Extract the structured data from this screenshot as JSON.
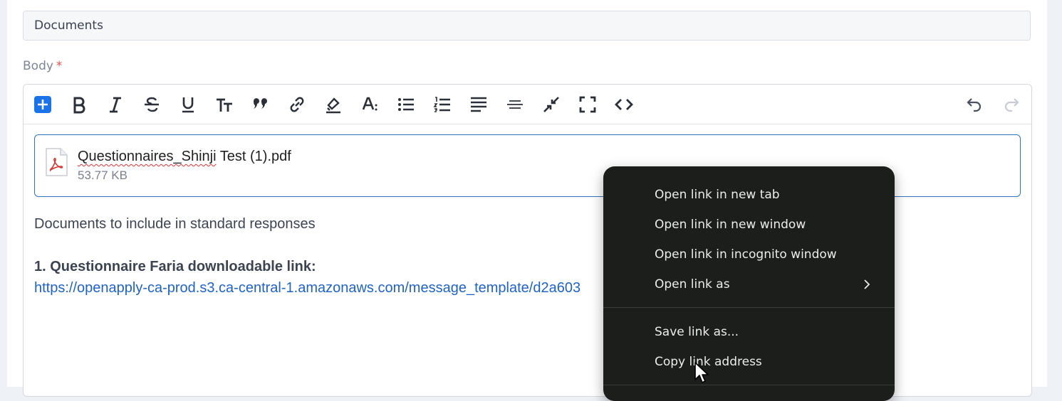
{
  "subject": {
    "value": "Documents"
  },
  "body_field": {
    "label": "Body",
    "required_marker": "*"
  },
  "toolbar": {
    "left_buttons": [
      "plus-icon",
      "bold-icon",
      "italic-icon",
      "strikethrough-icon",
      "underline-icon",
      "font-size-icon",
      "quote-icon",
      "link-icon",
      "text-highlight-icon",
      "text-color-icon",
      "bullet-list-icon",
      "numbered-list-icon",
      "align-icon",
      "horizontal-rule-icon",
      "collapse-icon",
      "fullscreen-icon",
      "code-view-icon"
    ],
    "right_buttons": [
      "undo-icon",
      "redo-icon"
    ],
    "accent_color": "#1a73e8"
  },
  "attachment": {
    "name_part1": "Questionnaires_Shinji",
    "name_part2": " Test (1).pdf",
    "size": "53.77 KB"
  },
  "content": {
    "intro": "Documents to include in standard responses",
    "item1_heading": "1. Questionnaire Faria downloadable link:",
    "item1_link": "https://openapply-ca-prod.s3.ca-central-1.amazonaws.com/message_template/d2a603"
  },
  "context_menu": {
    "items": [
      "Open link in new tab",
      "Open link in new window",
      "Open link in incognito window",
      "Open link as",
      "Save link as...",
      "Copy link address"
    ],
    "background_color": "#1c1e1b"
  }
}
